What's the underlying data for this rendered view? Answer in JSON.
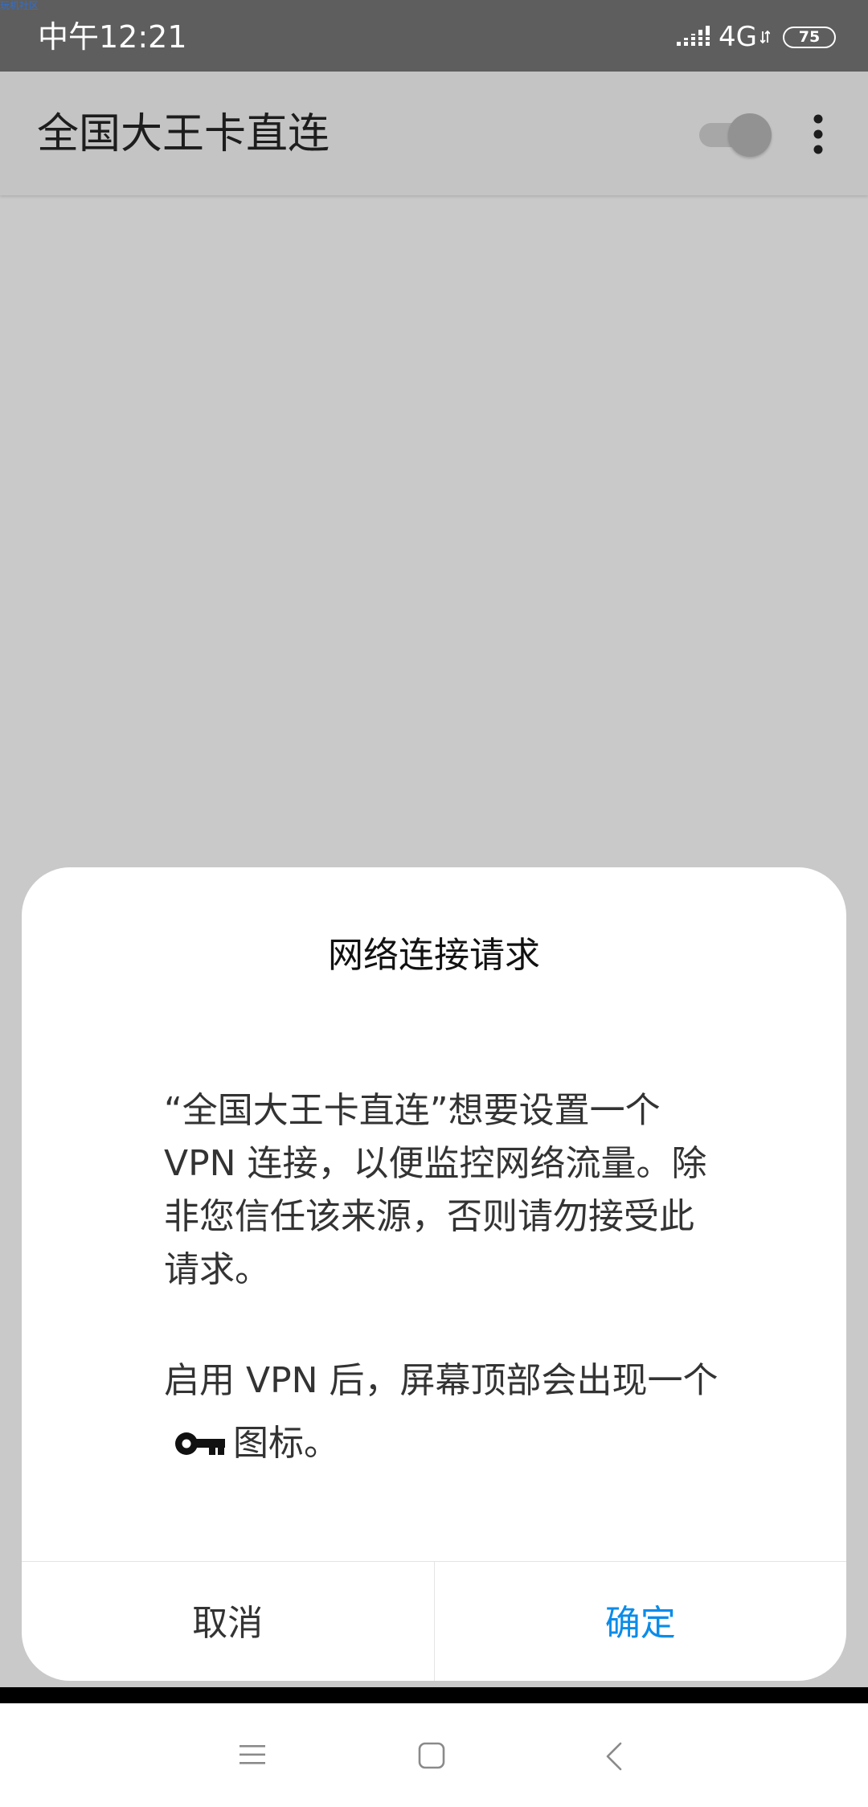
{
  "status_bar": {
    "watermark": "玩机社区",
    "time": "中午12:21",
    "network_type": "4G",
    "battery_level": "75",
    "battery_fraction": 0.75
  },
  "app_bar": {
    "title": "全国大王卡直连",
    "vpn_toggle_on": false
  },
  "dialog": {
    "title": "网络连接请求",
    "message_1": "“全国大王卡直连”想要设置一个 VPN 连接，以便监控网络流量。除非您信任该来源，否则请勿接受此请求。",
    "message_2_before_icon": "启用 VPN 后，屏幕顶部会出现一个",
    "message_2_after_icon": "图标。",
    "key_icon": "key-icon",
    "cancel_label": "取消",
    "confirm_label": "确定",
    "confirm_color": "#0b8ce9"
  },
  "nav_bar": {
    "icons": [
      "menu-icon",
      "home-icon",
      "back-icon"
    ]
  }
}
